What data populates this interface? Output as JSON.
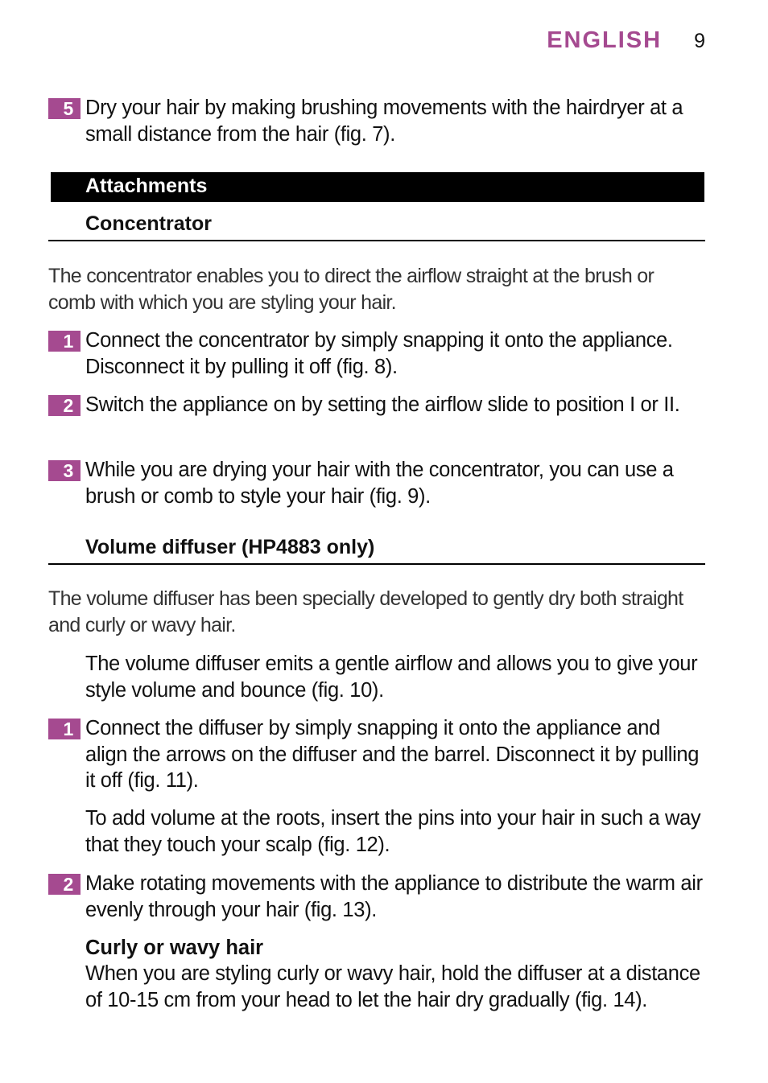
{
  "header": {
    "language": "ENGLISH",
    "page_number": "9"
  },
  "colors": {
    "accent": "#a54a90",
    "section_bar": "#000000"
  },
  "step_5": {
    "number": "5",
    "text": "Dry your hair by making brushing movements with the hairdryer at a small distance from the hair (fig. 7)."
  },
  "section": {
    "title": "Attachments"
  },
  "concentrator": {
    "heading": "Concentrator",
    "intro": "The concentrator enables you to direct the airflow straight at the brush or comb with which you are styling your hair.",
    "steps": [
      {
        "number": "1",
        "text": "Connect the concentrator by simply snapping it onto the appliance. Disconnect it by pulling it off (fig. 8)."
      },
      {
        "number": "2",
        "text": "Switch the appliance on by setting the airflow slide to position I or II."
      },
      {
        "number": "3",
        "text": "While you are drying your hair with the concentrator, you can use a brush or comb to style your hair (fig. 9)."
      }
    ]
  },
  "diffuser": {
    "heading": "Volume diffuser (HP4883 only)",
    "intro": "The volume diffuser has been specially developed to gently dry both straight and curly or wavy hair.",
    "note": "The volume diffuser emits a gentle airflow and allows you to give your style volume and bounce (fig. 10).",
    "steps": [
      {
        "number": "1",
        "text": "Connect the diffuser by simply snapping it onto the appliance and align the arrows on the diffuser and the barrel. Disconnect it by pulling it off (fig. 11)."
      },
      {
        "number": "2",
        "text": "Make rotating movements with the appliance to distribute the warm air evenly through your hair (fig. 13)."
      }
    ],
    "roots_note": "To add volume at the roots, insert the pins into your hair in such a way that they touch your scalp (fig. 12).",
    "curly": {
      "heading": "Curly or wavy hair",
      "text": "When you are styling curly or wavy hair, hold the diffuser at a distance of 10-15 cm from your head to let the hair dry gradually (fig. 14)."
    }
  }
}
